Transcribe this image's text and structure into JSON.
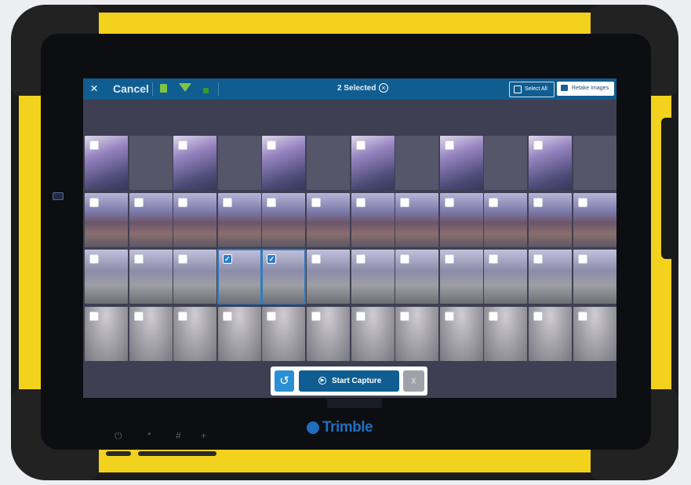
{
  "device": {
    "brand": "Trimble",
    "hardware_keys": [
      "⏻",
      "*",
      "#",
      "+"
    ]
  },
  "topbar": {
    "close_icon": "×",
    "cancel_label": "Cancel",
    "selected_label": "2 Selected",
    "clear_icon": "×",
    "select_all_label": "Select All",
    "retake_label": "Retake Images"
  },
  "grid": {
    "columns": 12,
    "rows": [
      [
        true,
        false,
        true,
        false,
        true,
        false,
        true,
        false,
        true,
        false,
        true,
        false
      ],
      [
        true,
        true,
        true,
        true,
        true,
        true,
        true,
        true,
        true,
        true,
        true,
        true
      ],
      [
        true,
        true,
        true,
        true,
        true,
        true,
        true,
        true,
        true,
        true,
        true,
        true
      ],
      [
        true,
        true,
        true,
        true,
        true,
        true,
        true,
        true,
        true,
        true,
        true,
        true
      ]
    ],
    "selected": [
      [
        2,
        3
      ],
      [
        2,
        4
      ]
    ]
  },
  "bottom": {
    "history_icon": "history-icon",
    "start_label": "Start Capture",
    "light_icon": "light-off-icon"
  },
  "colors": {
    "primary": "#0f5d91",
    "accent": "#2f7cc1",
    "device_yellow": "#f2d21c"
  }
}
